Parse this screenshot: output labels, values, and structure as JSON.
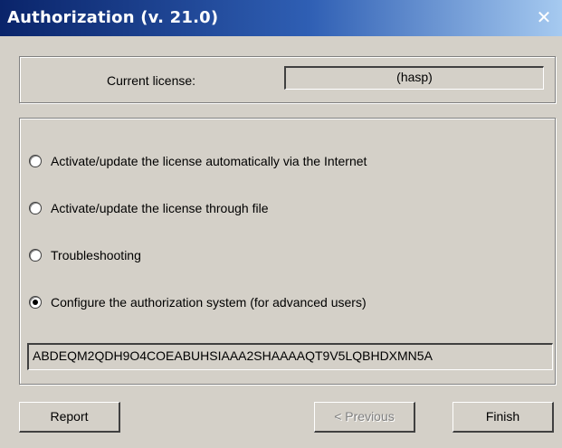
{
  "window": {
    "title": "Authorization (v. 21.0)",
    "close_symbol": "✕"
  },
  "license": {
    "label": "Current license:",
    "value": "(hasp)"
  },
  "options": [
    {
      "label": "Activate/update the license automatically via the Internet",
      "selected": false
    },
    {
      "label": "Activate/update the license through file",
      "selected": false
    },
    {
      "label": "Troubleshooting",
      "selected": false
    },
    {
      "label": "Configure the authorization system (for advanced users)",
      "selected": true
    }
  ],
  "code": {
    "value": "ABDEQM2QDH9O4COEABUHSIAAA2SHAAAAQT9V5LQBHDXMN5A"
  },
  "buttons": {
    "report": "Report",
    "previous": "< Previous",
    "finish": "Finish"
  }
}
